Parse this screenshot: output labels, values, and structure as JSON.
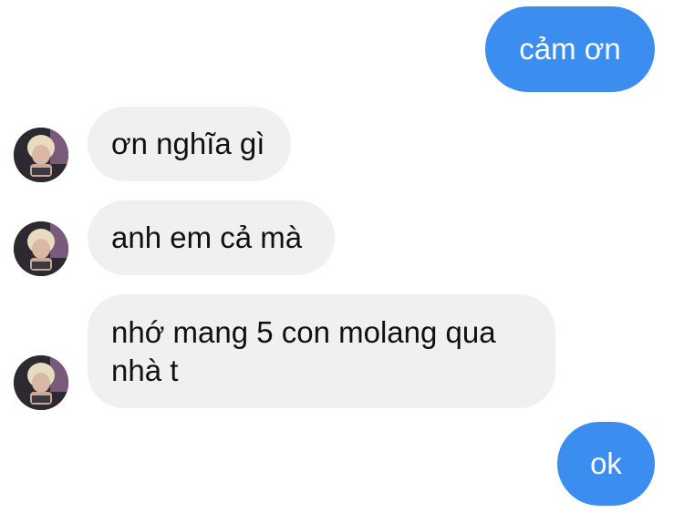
{
  "conversation": {
    "messages": [
      {
        "direction": "outgoing",
        "text": "cảm ơn"
      },
      {
        "direction": "incoming",
        "text": "ơn nghĩa gì"
      },
      {
        "direction": "incoming",
        "text": "anh em cả mà"
      },
      {
        "direction": "incoming",
        "text": "nhớ mang 5 con molang qua\nnhà t"
      },
      {
        "direction": "outgoing",
        "text": "ok"
      }
    ]
  },
  "colors": {
    "outgoing_bubble": "#3b8ef0",
    "incoming_bubble": "#f0f0f0"
  }
}
